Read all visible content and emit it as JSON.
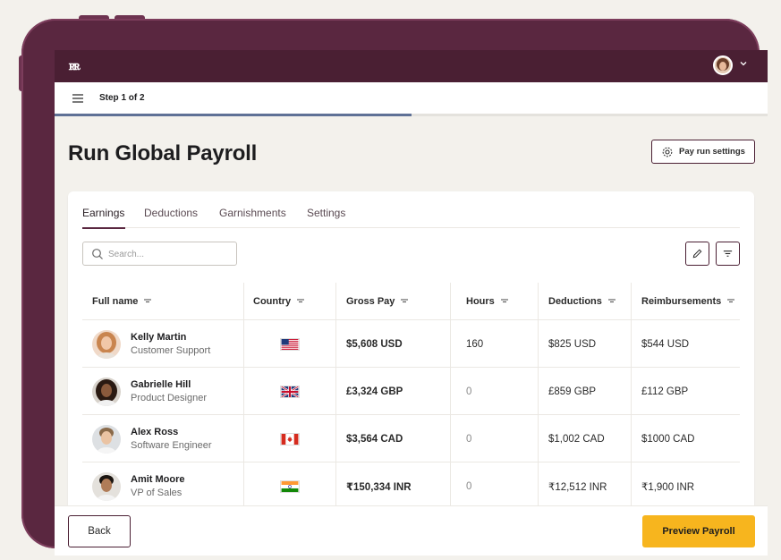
{
  "app": {
    "logo_text": "ꭱꭱ",
    "step_label": "Step 1 of 2",
    "progress": 0.5
  },
  "header": {
    "title": "Run Global Payroll",
    "settings_button": "Pay run settings"
  },
  "tabs": [
    {
      "label": "Earnings",
      "active": true
    },
    {
      "label": "Deductions",
      "active": false
    },
    {
      "label": "Garnishments",
      "active": false
    },
    {
      "label": "Settings",
      "active": false
    }
  ],
  "search": {
    "placeholder": "Search...",
    "value": ""
  },
  "table": {
    "columns": [
      "Full name",
      "Country",
      "Gross Pay",
      "Hours",
      "Deductions",
      "Reimbursements"
    ],
    "rows": [
      {
        "name": "Kelly Martin",
        "role": "Customer Support",
        "country": "US",
        "gross_pay": "$5,608 USD",
        "hours": "160",
        "deductions": "$825 USD",
        "reimbursements": "$544 USD"
      },
      {
        "name": "Gabrielle Hill",
        "role": "Product Designer",
        "country": "GB",
        "gross_pay": "£3,324 GBP",
        "hours": "0",
        "deductions": "£859 GBP",
        "reimbursements": "£112 GBP"
      },
      {
        "name": "Alex Ross",
        "role": "Software Engineer",
        "country": "CA",
        "gross_pay": "$3,564 CAD",
        "hours": "0",
        "deductions": "$1,002 CAD",
        "reimbursements": "$1000 CAD"
      },
      {
        "name": "Amit Moore",
        "role": "VP of Sales",
        "country": "IN",
        "gross_pay": "₹150,334 INR",
        "hours": "0",
        "deductions": "₹12,512 INR",
        "reimbursements": "₹1,900 INR"
      }
    ]
  },
  "footer": {
    "back_label": "Back",
    "preview_label": "Preview Payroll"
  },
  "colors": {
    "frame": "#5a2740",
    "topbar": "#4a1f33",
    "accent": "#f7b51e",
    "progress": "#5f7196"
  }
}
